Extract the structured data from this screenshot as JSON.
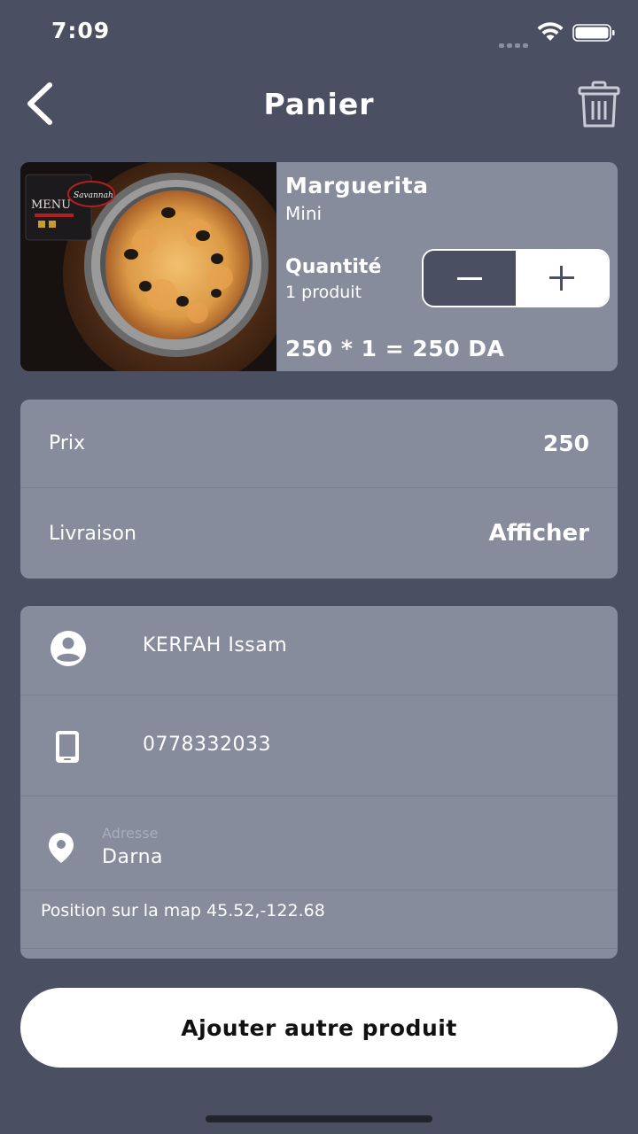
{
  "status_bar": {
    "time": "7:09"
  },
  "header": {
    "title": "Panier",
    "back_icon": "chevron-left-icon",
    "trash_icon": "trash-icon"
  },
  "product": {
    "name": "Marguerita",
    "size": "Mini",
    "quantity_label": "Quantité",
    "quantity_count": "1 produit",
    "total": "250 * 1 = 250 DA",
    "image_logo": "Savannah",
    "image_menu": "MENU"
  },
  "summary": {
    "price_label": "Prix",
    "price_value": "250",
    "delivery_label": "Livraison",
    "delivery_action": "Afficher"
  },
  "customer": {
    "name": "KERFAH Issam",
    "phone": "0778332033",
    "address_label": "Adresse",
    "address_value": "Darna",
    "position": "Position sur la map 45.52,-122.68"
  },
  "actions": {
    "add_product": "Ajouter autre produit"
  },
  "colors": {
    "background": "#4a4f62",
    "card": "#878c9c",
    "button": "#ffffff"
  }
}
